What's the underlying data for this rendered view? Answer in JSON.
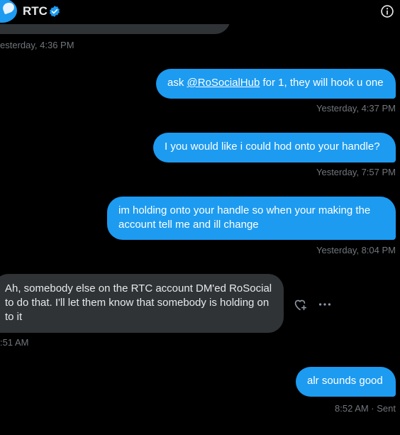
{
  "header": {
    "title": "RTC",
    "verified_icon": "verified-badge-icon",
    "info_icon": "info-icon"
  },
  "colors": {
    "background": "#000000",
    "outgoing_bubble": "#1d9bf0",
    "incoming_bubble": "#2f3336",
    "meta_text": "#71767b",
    "verified": "#1d9bf0"
  },
  "top_meta": "esterday, 4:36 PM",
  "messages": [
    {
      "direction": "outgoing",
      "parts": {
        "before": "ask ",
        "mention": "@RoSocialHub",
        "after": " for 1, they will hook u one"
      },
      "timestamp": "Yesterday, 4:37 PM"
    },
    {
      "direction": "outgoing",
      "text": "I you would like i could hod onto your handle?",
      "timestamp": "Yesterday, 7:57 PM"
    },
    {
      "direction": "outgoing",
      "text": "im holding onto your handle so when your making the account tell me and ill change",
      "timestamp": "Yesterday, 8:04 PM"
    },
    {
      "direction": "incoming",
      "text": "Ah, somebody else on the RTC account DM'ed RoSocial to do that. I'll let them know that somebody is holding on to it",
      "timestamp": ":51 AM",
      "actions": {
        "react_icon": "heart-plus-icon",
        "more_icon": "more-icon"
      }
    },
    {
      "direction": "outgoing",
      "text": "alr sounds good",
      "timestamp": "8:52 AM · Sent"
    }
  ]
}
